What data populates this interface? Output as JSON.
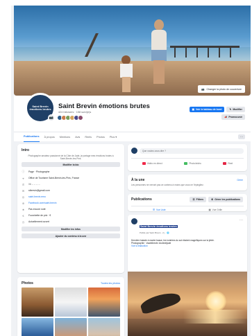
{
  "cover": {
    "edit_button_label": "Changer la photo de couverture"
  },
  "header": {
    "page_name": "Saint Brevin émotions brutes",
    "stats": "424 followers · 158 suivi(e)s",
    "avatar_text": "Saint Brevin émotions brutes",
    "edit_emoji": "✎",
    "primary_action_label": "Voir le tableau de bord",
    "edit_label": "Modifier",
    "promote_label": "Promouvoir",
    "follower_colors": [
      "#2b5c8a",
      "#c97b4a",
      "#7a9c5a",
      "#d6a55e",
      "#4a4a8a",
      "#8a4a6a"
    ]
  },
  "tabs": {
    "items": [
      "Publications",
      "À propos",
      "Mentions",
      "Avis",
      "Reels",
      "Photos",
      "Plus ▾"
    ],
    "active": "Publications",
    "more_icon": "···"
  },
  "intro": {
    "title": "Intro",
    "description": "Photographe amateur passionné de la Côte de Jade, je partage mes émotions brutes à Saint-Brevin-les-Pins.",
    "edit_bio_label": "Modifier la bio",
    "rows": [
      {
        "icon": "info-icon",
        "glyph": "ⓘ",
        "text": "Page · Photographe",
        "kind": "plain"
      },
      {
        "icon": "location-icon",
        "glyph": "⌖",
        "text": "Office de Tourisme Saint-Brevin-les-Pins, France",
        "kind": "plain"
      },
      {
        "icon": "phone-icon",
        "glyph": "✆",
        "text": "06 -- -- -- --",
        "kind": "muted"
      },
      {
        "icon": "email-icon",
        "glyph": "✉",
        "text": "stbrevin@gmail.com",
        "kind": "plain"
      },
      {
        "icon": "instagram-icon",
        "glyph": "◎",
        "text": "saint.brevin.emo",
        "kind": "link"
      },
      {
        "icon": "website-icon",
        "glyph": "⊕",
        "text": "Facebook.com/saint.brevin",
        "kind": "link"
      },
      {
        "icon": "rating-icon",
        "glyph": "★",
        "text": "Pas encore noté",
        "kind": "plain"
      },
      {
        "icon": "price-icon",
        "glyph": "€",
        "text": "Fourchette de prix · €",
        "kind": "plain"
      },
      {
        "icon": "clock-icon",
        "glyph": "◷",
        "text": "Actuellement ouvert",
        "kind": "plain"
      }
    ],
    "edit_details_label": "Modifier les infos",
    "add_featured_label": "Ajouter du contenu à la une"
  },
  "photos": {
    "title": "Photos",
    "see_all": "Toutes les photos",
    "tiles": [
      {
        "name": "photo-sunset-rocks",
        "bg": "linear-gradient(180deg,#c79b6a,#8b5a32 60%,#3b2a1e)"
      },
      {
        "name": "photo-phone-screen",
        "bg": "linear-gradient(180deg,#dcdcdc,#f5f5f5 50%,#b8c6d8)"
      },
      {
        "name": "photo-ocean-dusk",
        "bg": "linear-gradient(180deg,#d86b3c,#f1a25a 40%,#41566e)"
      },
      {
        "name": "photo-sphere-beach",
        "bg": "linear-gradient(180deg,#86b7e0,#2d5e9a 60%,#c9b08a)"
      },
      {
        "name": "photo-people-beach",
        "bg": "linear-gradient(180deg,#7fb2d9,#c79a7c 60%,#e6d4b4)"
      },
      {
        "name": "photo-children-shore",
        "bg": "linear-gradient(180deg,#9fc4dd,#d7c2ae 55%,#b8925f)"
      }
    ]
  },
  "composer": {
    "placeholder": "Que voulez-vous dire ?",
    "buttons": [
      {
        "name": "live-video-button",
        "label": "Vidéo en direct",
        "color": "#f02849"
      },
      {
        "name": "photo-video-button",
        "label": "Photo/vidéo",
        "color": "#45bd62"
      },
      {
        "name": "reel-button",
        "label": "Reel",
        "color": "#e42645"
      }
    ]
  },
  "featured": {
    "title": "À la une",
    "subtitle": "Les personnes ne verront pas ce contenu à moins que vous ne l'épingliez.",
    "see_all": "Gérer"
  },
  "publications": {
    "title": "Publications",
    "filters_label": "Filtres",
    "manage_label": "Gérer les publications",
    "views": [
      {
        "name": "list-view-tab",
        "label": "Vue Liste",
        "active": true
      },
      {
        "name": "grid-view-tab",
        "label": "Vue Grille",
        "active": false
      }
    ]
  },
  "post": {
    "author": "Saint Brevin émotions brutes",
    "meta": "Publié par Saint Brevin · 2 j · 🌐",
    "text_1": "Dernière balade à marée basse, les lumières du soir étaient magnifiques sur la jetée.",
    "text_2": "Photographie · #saintbrevin #cotedejade",
    "link": "Voir la traduction",
    "more": "···"
  }
}
